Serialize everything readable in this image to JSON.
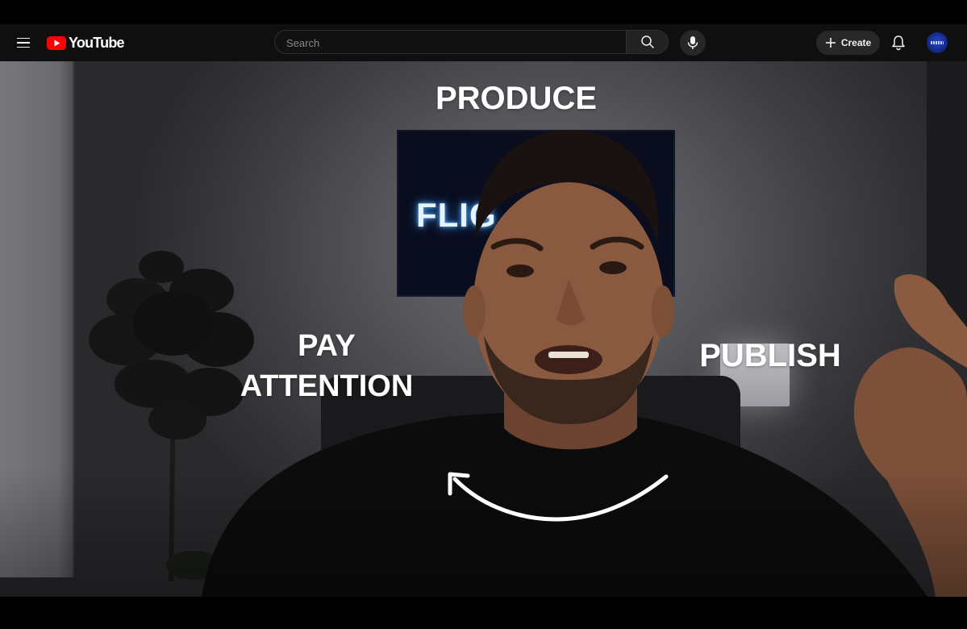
{
  "header": {
    "logo_text": "YouTube",
    "search_placeholder": "Search",
    "create_label": "Create"
  },
  "icons": {
    "menu": "menu-icon",
    "logo": "youtube-logo-icon",
    "search": "search-icon",
    "mic": "mic-icon",
    "create": "plus-icon",
    "notifications": "bell-icon",
    "avatar": "avatar"
  },
  "video": {
    "overlay_produce": "PRODUCE",
    "overlay_pay_line1": "PAY",
    "overlay_pay_line2": "ATTENTION",
    "overlay_publish": "PUBLISH",
    "tv_text": "FLIG"
  },
  "colors": {
    "brand_red": "#ff0000",
    "topbar_bg": "#0f0f0f",
    "text": "#f1f1f1"
  }
}
